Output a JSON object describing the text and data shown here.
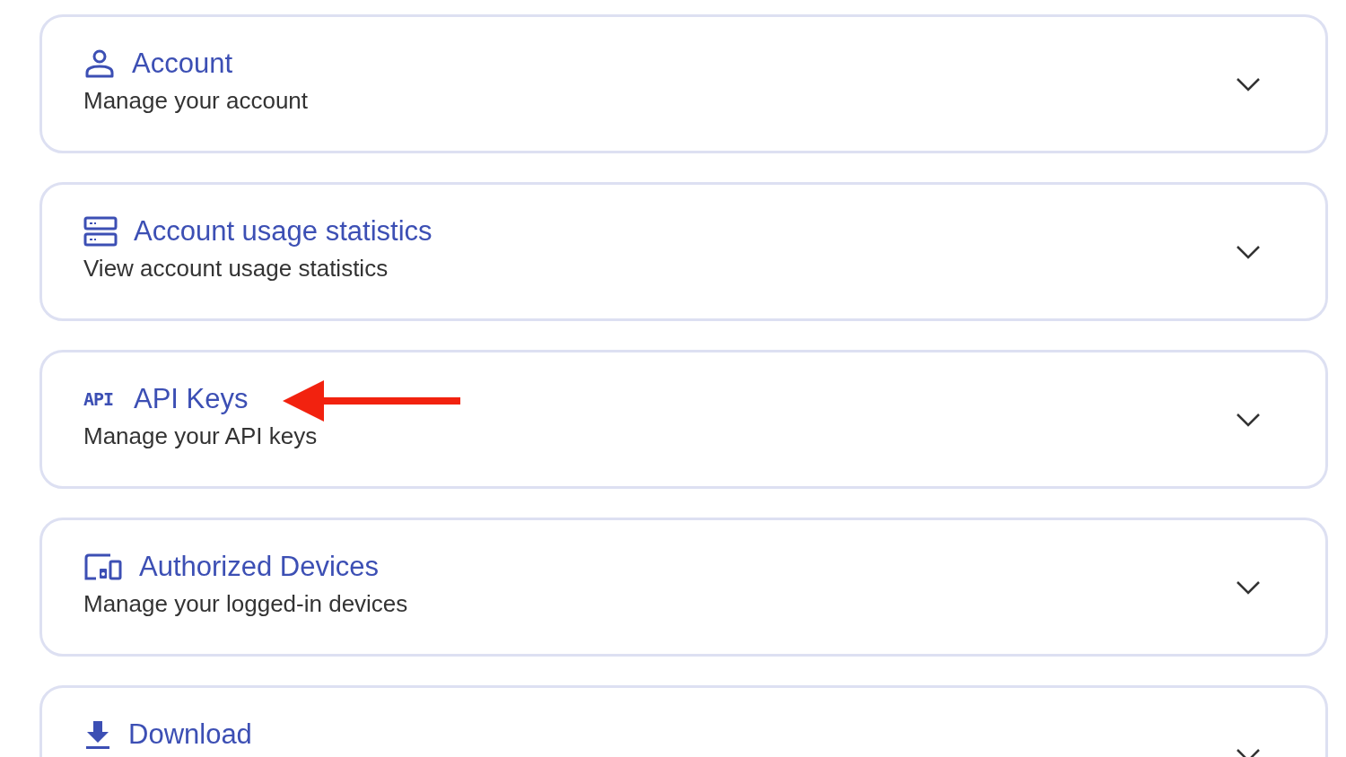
{
  "sections": [
    {
      "kind": "user",
      "title": "Account",
      "subtitle": "Manage your account",
      "pointer": false
    },
    {
      "kind": "storage",
      "title": "Account usage statistics",
      "subtitle": "View account usage statistics",
      "pointer": false
    },
    {
      "kind": "api",
      "icon_text": "API",
      "title": "API Keys",
      "subtitle": "Manage your API keys",
      "pointer": true
    },
    {
      "kind": "devices",
      "title": "Authorized Devices",
      "subtitle": "Manage your logged-in devices",
      "pointer": false
    },
    {
      "kind": "download",
      "title": "Download",
      "pointer": false
    }
  ]
}
